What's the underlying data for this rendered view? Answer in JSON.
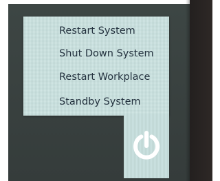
{
  "power_menu": {
    "items": [
      {
        "label": "Restart System"
      },
      {
        "label": "Shut Down System"
      },
      {
        "label": "Restart Workplace"
      },
      {
        "label": "Standby System"
      }
    ]
  },
  "power_button": {
    "icon": "power-icon"
  },
  "colors": {
    "menu_background": "#c8e1df",
    "menu_text": "#23313e",
    "screen_background": "#3d4644",
    "power_icon": "#ffffff"
  }
}
